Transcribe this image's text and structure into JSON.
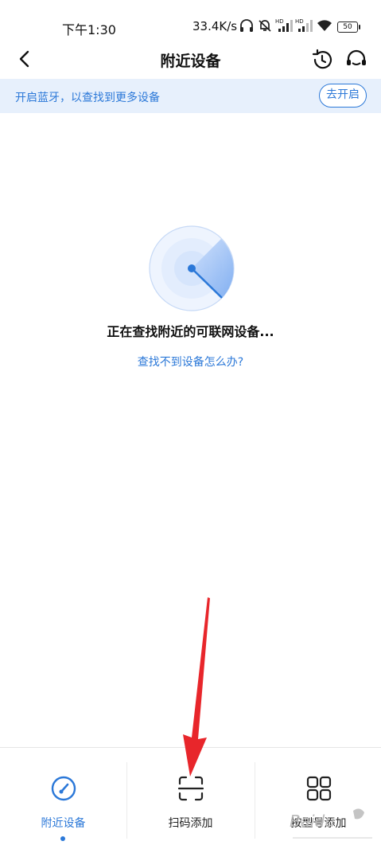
{
  "status_bar": {
    "time": "下午1:30",
    "network_speed": "33.4K/s",
    "battery": "50",
    "icons": [
      "headphones-icon",
      "mute-icon",
      "signal-hd-icon",
      "signal-hd-icon",
      "wifi-icon",
      "battery-icon"
    ]
  },
  "header": {
    "title": "附近设备",
    "back_icon": "chevron-left-icon",
    "history_icon": "history-clock-icon",
    "support_icon": "headset-icon"
  },
  "bluetooth_banner": {
    "text": "开启蓝牙，以查找到更多设备",
    "button_label": "去开启"
  },
  "scanning": {
    "status_text": "正在查找附近的可联网设备...",
    "help_link": "查找不到设备怎么办?",
    "icon": "radar-scan-icon"
  },
  "bottom_nav": {
    "items": [
      {
        "label": "附近设备",
        "icon": "gauge-icon",
        "active": true
      },
      {
        "label": "扫码添加",
        "icon": "scan-icon",
        "active": false
      },
      {
        "label": "按型号添加",
        "icon": "grid-icon",
        "active": false
      }
    ]
  },
  "watermark": {
    "text": "Baidu"
  },
  "colors": {
    "accent": "#2b78d8",
    "banner_bg": "#e7f0fc",
    "annotation_arrow": "#e8262b"
  }
}
